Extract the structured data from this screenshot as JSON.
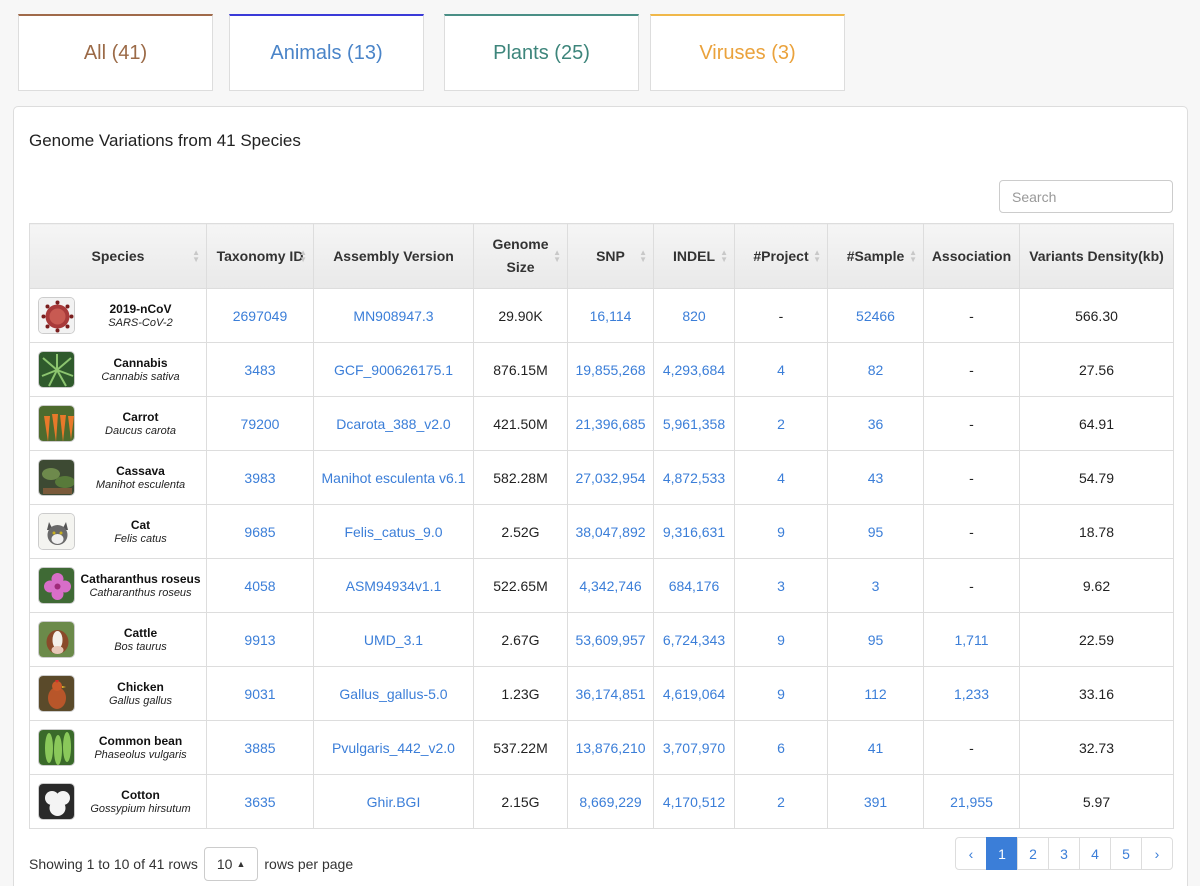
{
  "tabs": [
    {
      "label": "All (41)",
      "color": "#9b6a47"
    },
    {
      "label": "Animals (13)",
      "color": "#4a84c8"
    },
    {
      "label": "Plants (25)",
      "color": "#3d857b"
    },
    {
      "label": "Viruses (3)",
      "color": "#eaa23c"
    }
  ],
  "panel": {
    "title": "Genome Variations from 41 Species",
    "search_placeholder": "Search"
  },
  "table": {
    "headers": [
      "Species",
      "Taxonomy ID",
      "Assembly Version",
      "Genome Size",
      "SNP",
      "INDEL",
      "#Project",
      "#Sample",
      "Association",
      "Variants Density(kb)"
    ],
    "rows": [
      {
        "common": "2019-nCoV",
        "latin": "SARS-CoV-2",
        "icon": "virus-icon",
        "taxonomy": "2697049",
        "assembly": "MN908947.3",
        "size": "29.90K",
        "snp": "16,114",
        "indel": "820",
        "project": "-",
        "sample": "52466",
        "association": "-",
        "density": "566.30"
      },
      {
        "common": "Cannabis",
        "latin": "Cannabis sativa",
        "icon": "cannabis-icon",
        "taxonomy": "3483",
        "assembly": "GCF_900626175.1",
        "size": "876.15M",
        "snp": "19,855,268",
        "indel": "4,293,684",
        "project": "4",
        "sample": "82",
        "association": "-",
        "density": "27.56"
      },
      {
        "common": "Carrot",
        "latin": "Daucus carota",
        "icon": "carrot-icon",
        "taxonomy": "79200",
        "assembly": "Dcarota_388_v2.0",
        "size": "421.50M",
        "snp": "21,396,685",
        "indel": "5,961,358",
        "project": "2",
        "sample": "36",
        "association": "-",
        "density": "64.91"
      },
      {
        "common": "Cassava",
        "latin": "Manihot esculenta",
        "icon": "cassava-icon",
        "taxonomy": "3983",
        "assembly": "Manihot esculenta v6.1",
        "size": "582.28M",
        "snp": "27,032,954",
        "indel": "4,872,533",
        "project": "4",
        "sample": "43",
        "association": "-",
        "density": "54.79"
      },
      {
        "common": "Cat",
        "latin": "Felis catus",
        "icon": "cat-icon",
        "taxonomy": "9685",
        "assembly": "Felis_catus_9.0",
        "size": "2.52G",
        "snp": "38,047,892",
        "indel": "9,316,631",
        "project": "9",
        "sample": "95",
        "association": "-",
        "density": "18.78"
      },
      {
        "common": "Catharanthus roseus",
        "latin": "Catharanthus roseus",
        "icon": "flower-icon",
        "taxonomy": "4058",
        "assembly": "ASM94934v1.1",
        "size": "522.65M",
        "snp": "4,342,746",
        "indel": "684,176",
        "project": "3",
        "sample": "3",
        "association": "-",
        "density": "9.62"
      },
      {
        "common": "Cattle",
        "latin": "Bos taurus",
        "icon": "cattle-icon",
        "taxonomy": "9913",
        "assembly": "UMD_3.1",
        "size": "2.67G",
        "snp": "53,609,957",
        "indel": "6,724,343",
        "project": "9",
        "sample": "95",
        "association": "1,711",
        "density": "22.59"
      },
      {
        "common": "Chicken",
        "latin": "Gallus gallus",
        "icon": "chicken-icon",
        "taxonomy": "9031",
        "assembly": "Gallus_gallus-5.0",
        "size": "1.23G",
        "snp": "36,174,851",
        "indel": "4,619,064",
        "project": "9",
        "sample": "112",
        "association": "1,233",
        "density": "33.16"
      },
      {
        "common": "Common bean",
        "latin": "Phaseolus vulgaris",
        "icon": "bean-icon",
        "taxonomy": "3885",
        "assembly": "Pvulgaris_442_v2.0",
        "size": "537.22M",
        "snp": "13,876,210",
        "indel": "3,707,970",
        "project": "6",
        "sample": "41",
        "association": "-",
        "density": "32.73"
      },
      {
        "common": "Cotton",
        "latin": "Gossypium hirsutum",
        "icon": "cotton-icon",
        "taxonomy": "3635",
        "assembly": "Ghir.BGI",
        "size": "2.15G",
        "snp": "8,669,229",
        "indel": "4,170,512",
        "project": "2",
        "sample": "391",
        "association": "21,955",
        "density": "5.97"
      }
    ]
  },
  "footer": {
    "showing": "Showing 1 to 10 of 41 rows",
    "page_size": "10",
    "rows_per_page": "rows per page"
  },
  "pagination": {
    "prev": "‹",
    "pages": [
      "1",
      "2",
      "3",
      "4",
      "5"
    ],
    "next": "›",
    "active": "1"
  }
}
